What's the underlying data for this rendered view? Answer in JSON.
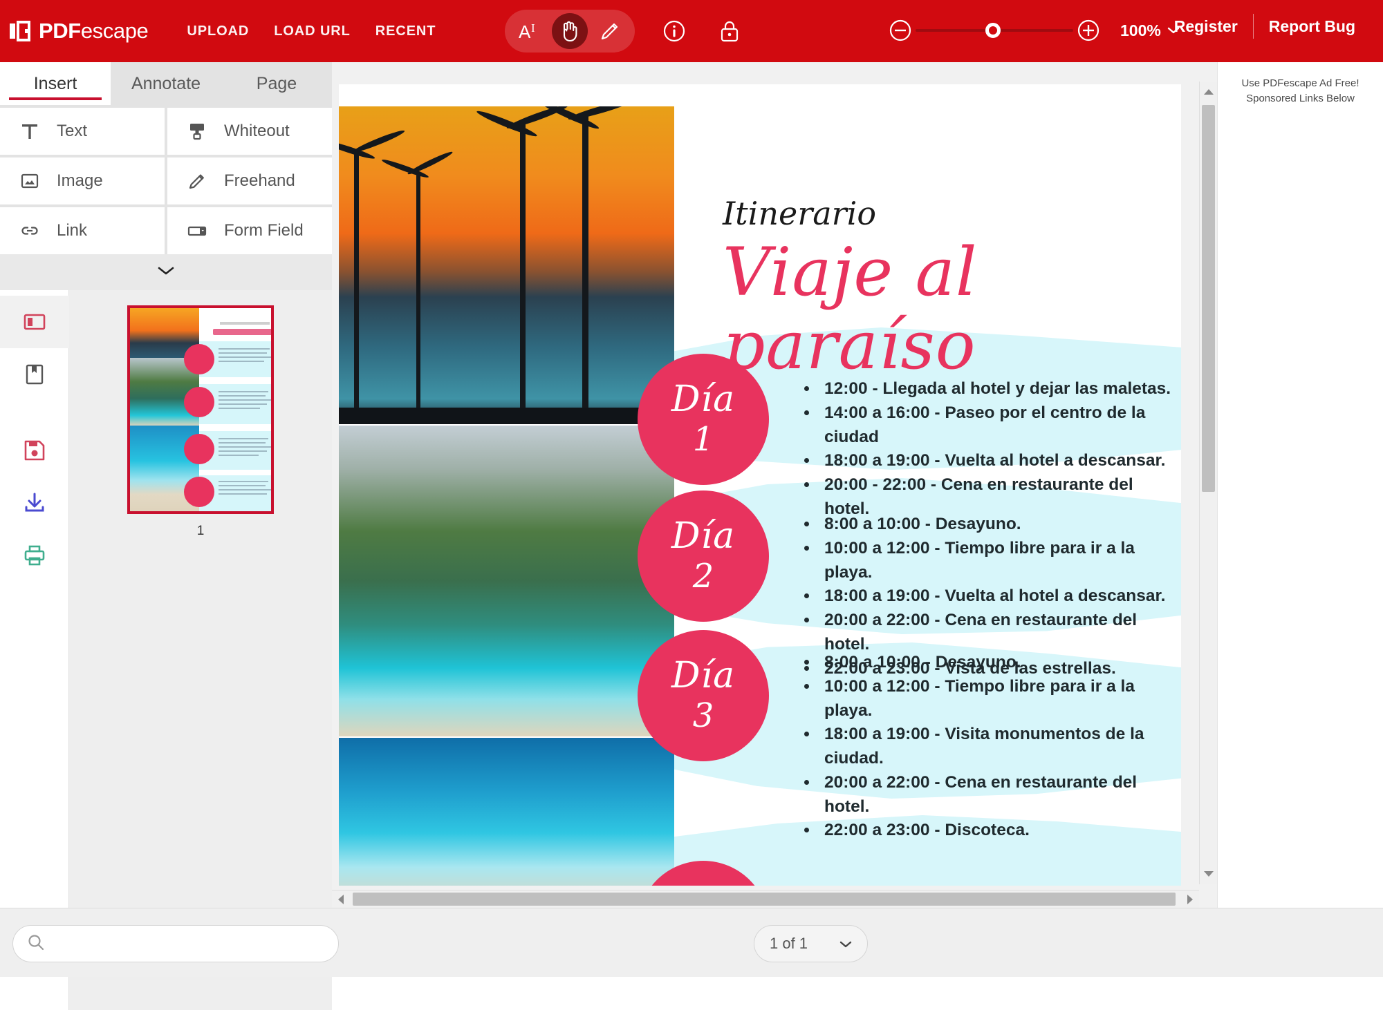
{
  "app": {
    "brand_primary": "PDF",
    "brand_secondary": "escape",
    "accent_color": "#d10a10",
    "nav": [
      {
        "label": "UPLOAD",
        "name": "nav-upload"
      },
      {
        "label": "LOAD URL",
        "name": "nav-load-url"
      },
      {
        "label": "RECENT",
        "name": "nav-recent"
      }
    ],
    "tools": [
      {
        "icon": "text-select-icon",
        "active": false
      },
      {
        "icon": "hand-tool-icon",
        "active": true
      },
      {
        "icon": "pencil-icon",
        "active": false
      }
    ],
    "info_icon": "info-icon",
    "lock_icon": "lock-icon",
    "zoom": {
      "minus_icon": "zoom-out-icon",
      "plus_icon": "zoom-in-icon",
      "value": "100%",
      "chevron": "chevron-down-icon"
    },
    "account": {
      "register": "Register",
      "report_bug": "Report Bug"
    }
  },
  "sidebar": {
    "tabs": [
      {
        "label": "Insert",
        "active": true
      },
      {
        "label": "Annotate",
        "active": false
      },
      {
        "label": "Page",
        "active": false
      }
    ],
    "tools": [
      {
        "label": "Text",
        "icon": "text-tool-icon"
      },
      {
        "label": "Whiteout",
        "icon": "whiteout-icon"
      },
      {
        "label": "Image",
        "icon": "image-icon"
      },
      {
        "label": "Freehand",
        "icon": "freehand-pencil-icon"
      },
      {
        "label": "Link",
        "icon": "link-icon"
      },
      {
        "label": "Form Field",
        "icon": "form-field-icon"
      }
    ],
    "expander_icon": "chevron-down-icon",
    "rail": [
      {
        "icon": "page-panel-icon",
        "selected": true,
        "color": "#d1435b"
      },
      {
        "icon": "bookmark-icon",
        "selected": false,
        "color": "#555555"
      },
      {
        "icon": "save-icon",
        "selected": false,
        "color": "#d1435b"
      },
      {
        "icon": "download-icon",
        "selected": false,
        "color": "#4a4ad0"
      },
      {
        "icon": "print-icon",
        "selected": false,
        "color": "#3fae8e"
      }
    ],
    "thumbnail_label": "1"
  },
  "bottom": {
    "search_placeholder": "",
    "search_value": "",
    "search_icon": "search-icon",
    "page_indicator": "1 of 1",
    "page_chevron": "chevron-down-icon"
  },
  "ads": {
    "line1": "Use PDFescape Ad Free!",
    "line2": "Sponsored Links Below"
  },
  "document": {
    "kicker": "Itinerario",
    "title": "Viaje al paraíso",
    "pink": "#e8335e",
    "band": "#d7f6fa",
    "days": [
      {
        "word": "Día",
        "number": "1",
        "items": [
          "12:00 - Llegada al hotel y dejar las maletas.",
          "14:00 a 16:00 - Paseo por el centro de la ciudad",
          "18:00 a 19:00 - Vuelta al hotel a descansar.",
          "20:00 - 22:00 - Cena en restaurante del hotel."
        ]
      },
      {
        "word": "Día",
        "number": "2",
        "items": [
          "8:00 a 10:00 - Desayuno.",
          "10:00 a 12:00 - Tiempo libre para ir a la playa.",
          "18:00 a 19:00 - Vuelta al hotel a descansar.",
          "20:00 a 22:00 - Cena en restaurante del hotel.",
          "22:00 a 23:00 - Vista de las estrellas."
        ]
      },
      {
        "word": "Día",
        "number": "3",
        "items": [
          "8:00 a 10:00 - Desayuno.",
          "10:00 a 12:00 - Tiempo libre para ir a la playa.",
          "18:00 a 19:00 - Visita monumentos de la ciudad.",
          "20:00 a 22:00 - Cena en restaurante del hotel.",
          "22:00 a 23:00 - Discoteca."
        ]
      }
    ]
  }
}
